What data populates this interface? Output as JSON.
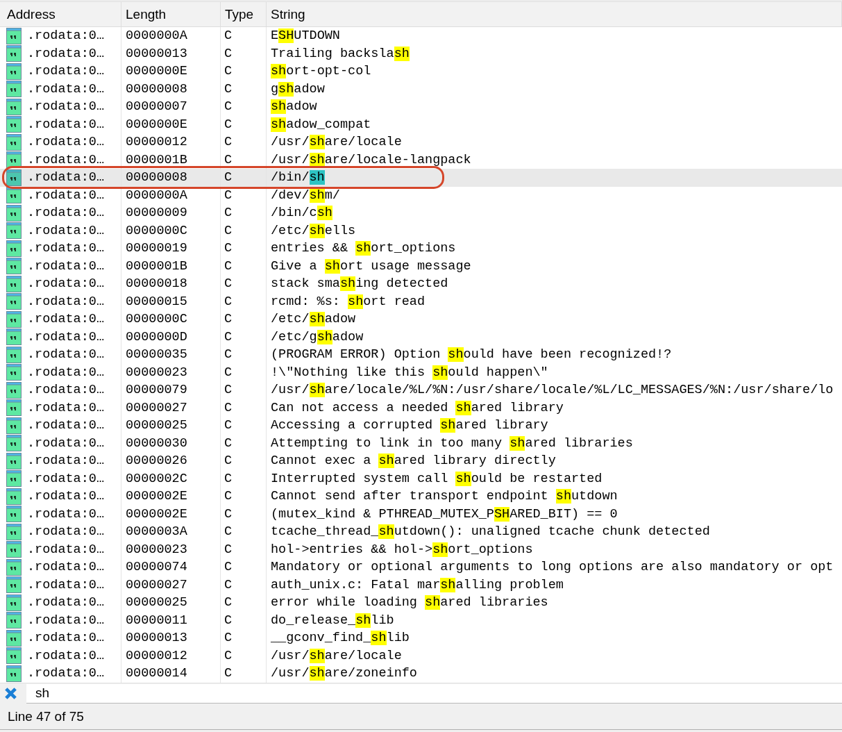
{
  "columns": [
    "Address",
    "Length",
    "Type",
    "String"
  ],
  "rows": [
    {
      "address": ".rodata:0…",
      "length": "0000000A",
      "type": "C",
      "string": "ESHUTDOWN",
      "selected": false,
      "circled": false
    },
    {
      "address": ".rodata:0…",
      "length": "00000013",
      "type": "C",
      "string": "Trailing backslash",
      "selected": false,
      "circled": false
    },
    {
      "address": ".rodata:0…",
      "length": "0000000E",
      "type": "C",
      "string": "short-opt-col",
      "selected": false,
      "circled": false
    },
    {
      "address": ".rodata:0…",
      "length": "00000008",
      "type": "C",
      "string": "gshadow",
      "selected": false,
      "circled": false
    },
    {
      "address": ".rodata:0…",
      "length": "00000007",
      "type": "C",
      "string": "shadow",
      "selected": false,
      "circled": false
    },
    {
      "address": ".rodata:0…",
      "length": "0000000E",
      "type": "C",
      "string": "shadow_compat",
      "selected": false,
      "circled": false
    },
    {
      "address": ".rodata:0…",
      "length": "00000012",
      "type": "C",
      "string": "/usr/share/locale",
      "selected": false,
      "circled": false
    },
    {
      "address": ".rodata:0…",
      "length": "0000001B",
      "type": "C",
      "string": "/usr/share/locale-langpack",
      "selected": false,
      "circled": false
    },
    {
      "address": ".rodata:0…",
      "length": "00000008",
      "type": "C",
      "string": "/bin/sh",
      "selected": true,
      "circled": true
    },
    {
      "address": ".rodata:0…",
      "length": "0000000A",
      "type": "C",
      "string": "/dev/shm/",
      "selected": false,
      "circled": false
    },
    {
      "address": ".rodata:0…",
      "length": "00000009",
      "type": "C",
      "string": "/bin/csh",
      "selected": false,
      "circled": false
    },
    {
      "address": ".rodata:0…",
      "length": "0000000C",
      "type": "C",
      "string": "/etc/shells",
      "selected": false,
      "circled": false
    },
    {
      "address": ".rodata:0…",
      "length": "00000019",
      "type": "C",
      "string": "entries && short_options",
      "selected": false,
      "circled": false
    },
    {
      "address": ".rodata:0…",
      "length": "0000001B",
      "type": "C",
      "string": "Give a short usage message",
      "selected": false,
      "circled": false
    },
    {
      "address": ".rodata:0…",
      "length": "00000018",
      "type": "C",
      "string": "stack smashing detected",
      "selected": false,
      "circled": false
    },
    {
      "address": ".rodata:0…",
      "length": "00000015",
      "type": "C",
      "string": "rcmd: %s: short read",
      "selected": false,
      "circled": false
    },
    {
      "address": ".rodata:0…",
      "length": "0000000C",
      "type": "C",
      "string": "/etc/shadow",
      "selected": false,
      "circled": false
    },
    {
      "address": ".rodata:0…",
      "length": "0000000D",
      "type": "C",
      "string": "/etc/gshadow",
      "selected": false,
      "circled": false
    },
    {
      "address": ".rodata:0…",
      "length": "00000035",
      "type": "C",
      "string": "(PROGRAM ERROR) Option should have been recognized!?",
      "selected": false,
      "circled": false
    },
    {
      "address": ".rodata:0…",
      "length": "00000023",
      "type": "C",
      "string": "!\\\"Nothing like this should happen\\\"",
      "selected": false,
      "circled": false
    },
    {
      "address": ".rodata:0…",
      "length": "00000079",
      "type": "C",
      "string": "/usr/share/locale/%L/%N:/usr/share/locale/%L/LC_MESSAGES/%N:/usr/share/lo",
      "selected": false,
      "circled": false
    },
    {
      "address": ".rodata:0…",
      "length": "00000027",
      "type": "C",
      "string": "Can not access a needed shared library",
      "selected": false,
      "circled": false
    },
    {
      "address": ".rodata:0…",
      "length": "00000025",
      "type": "C",
      "string": "Accessing a corrupted shared library",
      "selected": false,
      "circled": false
    },
    {
      "address": ".rodata:0…",
      "length": "00000030",
      "type": "C",
      "string": "Attempting to link in too many shared libraries",
      "selected": false,
      "circled": false
    },
    {
      "address": ".rodata:0…",
      "length": "00000026",
      "type": "C",
      "string": "Cannot exec a shared library directly",
      "selected": false,
      "circled": false
    },
    {
      "address": ".rodata:0…",
      "length": "0000002C",
      "type": "C",
      "string": "Interrupted system call should be restarted",
      "selected": false,
      "circled": false
    },
    {
      "address": ".rodata:0…",
      "length": "0000002E",
      "type": "C",
      "string": "Cannot send after transport endpoint shutdown",
      "selected": false,
      "circled": false
    },
    {
      "address": ".rodata:0…",
      "length": "0000002E",
      "type": "C",
      "string": "(mutex_kind & PTHREAD_MUTEX_PSHARED_BIT) == 0",
      "selected": false,
      "circled": false
    },
    {
      "address": ".rodata:0…",
      "length": "0000003A",
      "type": "C",
      "string": "tcache_thread_shutdown(): unaligned tcache chunk detected",
      "selected": false,
      "circled": false
    },
    {
      "address": ".rodata:0…",
      "length": "00000023",
      "type": "C",
      "string": "hol->entries && hol->short_options",
      "selected": false,
      "circled": false
    },
    {
      "address": ".rodata:0…",
      "length": "00000074",
      "type": "C",
      "string": "Mandatory or optional arguments to long options are also mandatory or opt",
      "selected": false,
      "circled": false
    },
    {
      "address": ".rodata:0…",
      "length": "00000027",
      "type": "C",
      "string": "auth_unix.c: Fatal marshalling problem",
      "selected": false,
      "circled": false
    },
    {
      "address": ".rodata:0…",
      "length": "00000025",
      "type": "C",
      "string": "error while loading shared libraries",
      "selected": false,
      "circled": false
    },
    {
      "address": ".rodata:0…",
      "length": "00000011",
      "type": "C",
      "string": "do_release_shlib",
      "selected": false,
      "circled": false
    },
    {
      "address": ".rodata:0…",
      "length": "00000013",
      "type": "C",
      "string": "__gconv_find_shlib",
      "selected": false,
      "circled": false
    },
    {
      "address": ".rodata:0…",
      "length": "00000012",
      "type": "C",
      "string": "/usr/share/locale",
      "selected": false,
      "circled": false
    },
    {
      "address": ".rodata:0…",
      "length": "00000014",
      "type": "C",
      "string": "/usr/share/zoneinfo",
      "selected": false,
      "circled": false
    }
  ],
  "filter": {
    "value": "sh"
  },
  "status_bar": "Line 47 of 75"
}
